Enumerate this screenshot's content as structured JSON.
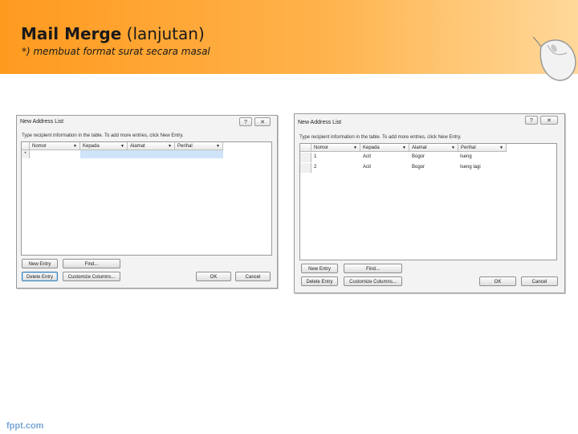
{
  "slide": {
    "title_bold": "Mail Merge",
    "title_rest": " (lanjutan)",
    "subtitle": "*) membuat format surat secara masal",
    "footer": "fppt.com"
  },
  "left_dialog": {
    "title": "New Address List",
    "help": "?",
    "close": "✕",
    "instruction": "Type recipient information in the table. To add more entries, click New Entry.",
    "columns": [
      "Nomor",
      "Kepada",
      "Alamat",
      "Perihal"
    ],
    "new_row_marker": "*",
    "buttons": {
      "new_entry": "New Entry",
      "find": "Find...",
      "delete_entry": "Delete Entry",
      "customize": "Customize Columns...",
      "ok": "OK",
      "cancel": "Cancel"
    }
  },
  "right_dialog": {
    "title": "New Address List",
    "help": "?",
    "close": "✕",
    "instruction": "Type recipient information in the table. To add more entries, click New Entry.",
    "columns": [
      "Nomor",
      "Kepada",
      "Alamat",
      "Perihal"
    ],
    "rows": [
      [
        "1",
        "Acit",
        "Bogor",
        "Iseng"
      ],
      [
        "2",
        "Acit",
        "Bogor",
        "Iseng lagi"
      ]
    ],
    "buttons": {
      "new_entry": "New Entry",
      "find": "Find...",
      "delete_entry": "Delete Entry",
      "customize": "Customize Columns...",
      "ok": "OK",
      "cancel": "Cancel"
    }
  }
}
